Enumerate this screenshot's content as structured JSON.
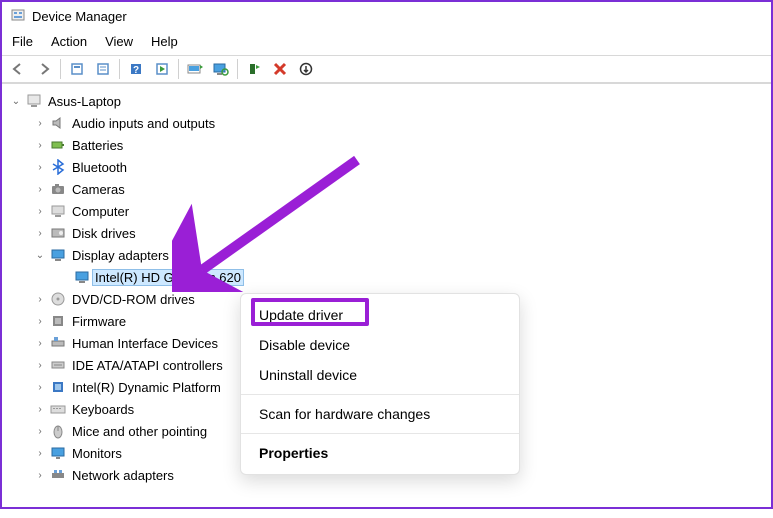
{
  "window": {
    "title": "Device Manager"
  },
  "menu": {
    "items": [
      "File",
      "Action",
      "View",
      "Help"
    ]
  },
  "toolbar": {
    "buttons": [
      "back-icon",
      "forward-icon",
      "sep",
      "show-hidden-icon",
      "properties-icon",
      "sep",
      "help-icon",
      "action-icon",
      "sep",
      "update-driver-icon",
      "scan-hardware-icon",
      "sep",
      "uninstall-icon",
      "disable-icon",
      "enable-icon"
    ]
  },
  "tree": {
    "root": {
      "label": "Asus-Laptop",
      "expanded": true
    },
    "categories": [
      {
        "label": "Audio inputs and outputs",
        "expanded": false,
        "icon": "speaker"
      },
      {
        "label": "Batteries",
        "expanded": false,
        "icon": "battery"
      },
      {
        "label": "Bluetooth",
        "expanded": false,
        "icon": "bluetooth"
      },
      {
        "label": "Cameras",
        "expanded": false,
        "icon": "camera"
      },
      {
        "label": "Computer",
        "expanded": false,
        "icon": "computer"
      },
      {
        "label": "Disk drives",
        "expanded": false,
        "icon": "disk"
      },
      {
        "label": "Display adapters",
        "expanded": true,
        "icon": "display",
        "children": [
          {
            "label": "Intel(R) HD Graphics 620",
            "selected": true,
            "icon": "display"
          }
        ]
      },
      {
        "label": "DVD/CD-ROM drives",
        "expanded": false,
        "icon": "cdrom"
      },
      {
        "label": "Firmware",
        "expanded": false,
        "icon": "firmware"
      },
      {
        "label": "Human Interface Devices",
        "expanded": false,
        "icon": "hid"
      },
      {
        "label": "IDE ATA/ATAPI controllers",
        "expanded": false,
        "icon": "ide"
      },
      {
        "label": "Intel(R) Dynamic Platform",
        "expanded": false,
        "icon": "intel"
      },
      {
        "label": "Keyboards",
        "expanded": false,
        "icon": "keyboard"
      },
      {
        "label": "Mice and other pointing",
        "expanded": false,
        "icon": "mouse"
      },
      {
        "label": "Monitors",
        "expanded": false,
        "icon": "monitor"
      },
      {
        "label": "Network adapters",
        "expanded": false,
        "icon": "network"
      }
    ]
  },
  "contextMenu": {
    "items": [
      {
        "label": "Update driver",
        "highlighted": true
      },
      {
        "label": "Disable device"
      },
      {
        "label": "Uninstall device"
      },
      {
        "sep": true
      },
      {
        "label": "Scan for hardware changes"
      },
      {
        "sep": true
      },
      {
        "label": "Properties",
        "bold": true
      }
    ]
  }
}
